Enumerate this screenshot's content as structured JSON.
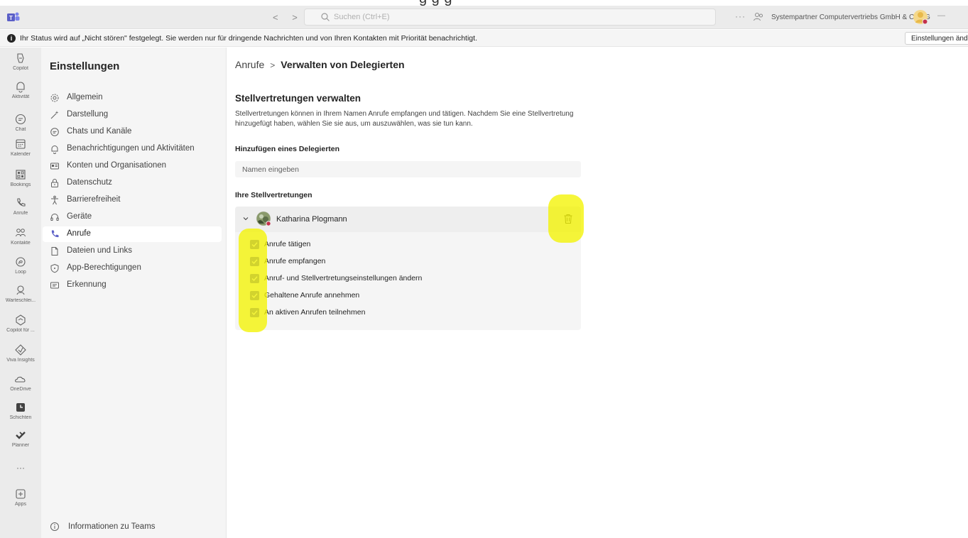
{
  "titlebar": {
    "search_placeholder": "Suchen (Ctrl+E)",
    "org_name": "Systempartner Computervertriebs GmbH & Co KG",
    "more_dots": "···",
    "back": "<",
    "forward": ">",
    "minimize": "—"
  },
  "notification": {
    "text": "Ihr Status wird auf „Nicht stören\" festgelegt. Sie werden nur für dringende Nachrichten und von Ihren Kontakten mit Priorität benachrichtigt.",
    "button": "Einstellungen änd"
  },
  "rail": {
    "items": [
      {
        "label": "Copilot",
        "icon": "copilot-icon"
      },
      {
        "label": "Aktivität",
        "icon": "bell-icon"
      },
      {
        "label": "Chat",
        "icon": "chat-icon"
      },
      {
        "label": "Kalender",
        "icon": "calendar-icon"
      },
      {
        "label": "Bookings",
        "icon": "bookings-icon"
      },
      {
        "label": "Anrufe",
        "icon": "phone-icon"
      },
      {
        "label": "Kontakte",
        "icon": "contacts-icon"
      },
      {
        "label": "Loop",
        "icon": "loop-icon"
      },
      {
        "label": "Warteschlei...",
        "icon": "queue-icon"
      },
      {
        "label": "Copilot für ...",
        "icon": "copilot-for-icon"
      },
      {
        "label": "Viva Insights",
        "icon": "viva-insights-icon"
      },
      {
        "label": "OneDrive",
        "icon": "onedrive-icon"
      },
      {
        "label": "Schichten",
        "icon": "shifts-icon"
      },
      {
        "label": "Planner",
        "icon": "planner-icon"
      },
      {
        "label": "Apps",
        "icon": "apps-icon"
      }
    ],
    "more": "···"
  },
  "sidebar": {
    "title": "Einstellungen",
    "items": [
      {
        "label": "Allgemein",
        "icon": "gear-icon"
      },
      {
        "label": "Darstellung",
        "icon": "wand-icon"
      },
      {
        "label": "Chats und Kanäle",
        "icon": "chat-icon"
      },
      {
        "label": "Benachrichtigungen und Aktivitäten",
        "icon": "bell-icon"
      },
      {
        "label": "Konten und Organisationen",
        "icon": "id-card-icon"
      },
      {
        "label": "Datenschutz",
        "icon": "lock-icon"
      },
      {
        "label": "Barrierefreiheit",
        "icon": "accessibility-icon"
      },
      {
        "label": "Geräte",
        "icon": "headset-icon"
      },
      {
        "label": "Anrufe",
        "icon": "phone-icon"
      },
      {
        "label": "Dateien und Links",
        "icon": "file-icon"
      },
      {
        "label": "App-Berechtigungen",
        "icon": "shield-icon"
      },
      {
        "label": "Erkennung",
        "icon": "recognition-icon"
      }
    ],
    "active": "Anrufe",
    "footer": "Informationen zu Teams"
  },
  "main": {
    "breadcrumb_parent": "Anrufe",
    "breadcrumb_sep": ">",
    "breadcrumb_current": "Verwalten von Delegierten",
    "heading": "Stellvertretungen verwalten",
    "description": "Stellvertretungen können in Ihrem Namen Anrufe empfangen und tätigen. Nachdem Sie eine Stellvertretung hinzugefügt haben, wählen Sie sie aus, um auszuwählen, was sie tun kann.",
    "add_label": "Hinzufügen eines Delegierten",
    "add_placeholder": "Namen eingeben",
    "delegates_label": "Ihre Stellvertretungen",
    "delegate": {
      "name": "Katharina Plogmann",
      "permissions": [
        {
          "label": "Anrufe tätigen",
          "checked": true
        },
        {
          "label": "Anrufe empfangen",
          "checked": true
        },
        {
          "label": "Anruf- und Stellvertretungseinstellungen ändern",
          "checked": true
        },
        {
          "label": "Gehaltene Anrufe annehmen",
          "checked": true
        },
        {
          "label": "An aktiven Anrufen teilnehmen",
          "checked": true
        }
      ]
    }
  },
  "colors": {
    "accent": "#5b5fc7",
    "highlight": "#f4f403",
    "status_dnd": "#c4314b"
  }
}
